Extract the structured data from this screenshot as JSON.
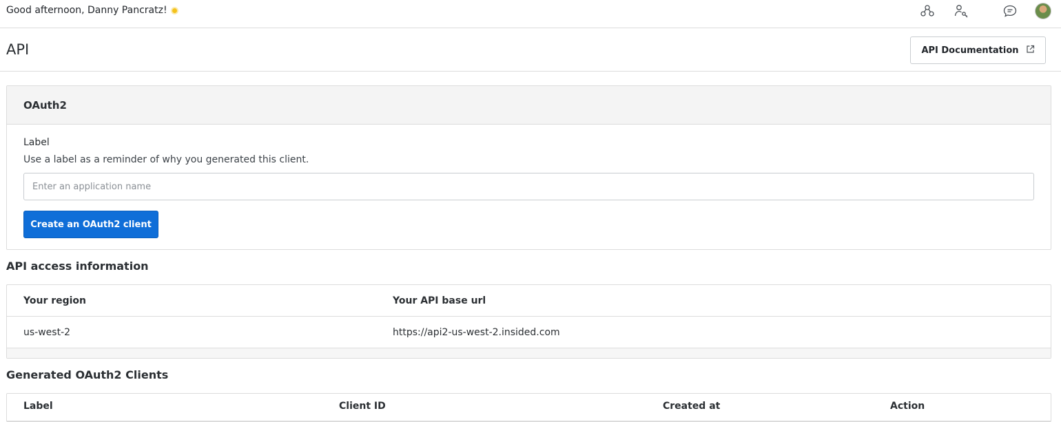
{
  "topbar": {
    "greeting": "Good afternoon, Danny Pancratz!",
    "icons": [
      "community-icon",
      "user-key-icon",
      "chat-icon",
      "avatar"
    ]
  },
  "header": {
    "title": "API",
    "doc_button": "API Documentation"
  },
  "oauth": {
    "title": "OAuth2",
    "label": "Label",
    "help": "Use a label as a reminder of why you generated this client.",
    "input_value": "",
    "input_placeholder": "Enter an application name",
    "create_button": "Create an OAuth2 client"
  },
  "access": {
    "title": "API access information",
    "columns": [
      "Your region",
      "Your API base url"
    ],
    "rows": [
      [
        "us-west-2",
        "https://api2-us-west-2.insided.com"
      ]
    ]
  },
  "clients": {
    "title": "Generated OAuth2 Clients",
    "columns": [
      "Label",
      "Client ID",
      "Created at",
      "Action"
    ]
  },
  "colors": {
    "primary": "#0f6ed8",
    "border": "#dcdcdc",
    "card_header_bg": "#f4f4f4"
  }
}
